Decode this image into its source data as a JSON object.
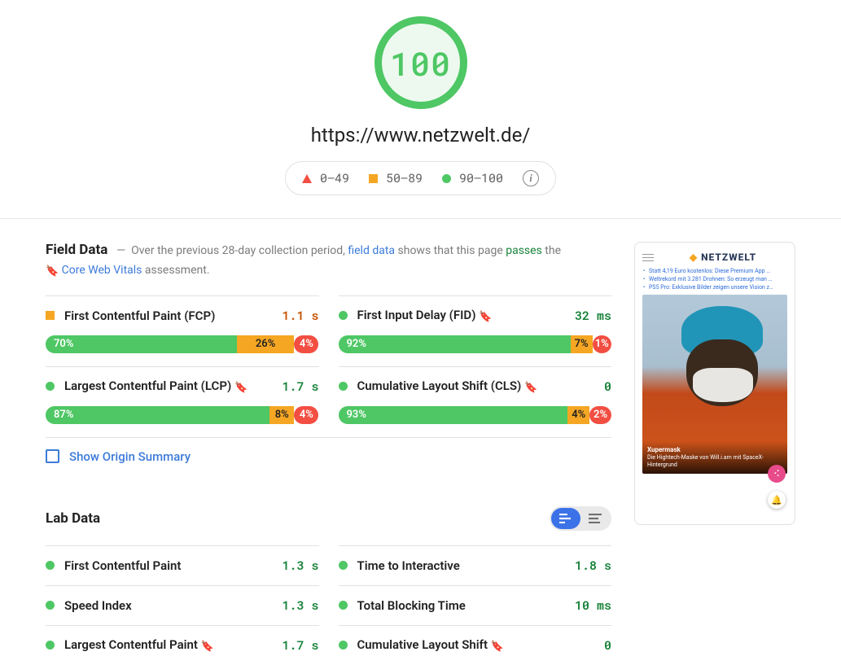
{
  "header": {
    "score": "100",
    "url": "https://www.netzwelt.de/",
    "legend": {
      "poor": "0–49",
      "ni": "50–89",
      "good": "90–100"
    }
  },
  "field": {
    "title": "Field Data",
    "intro_pre": "Over the previous 28-day collection period, ",
    "intro_link1": "field data",
    "intro_mid": " shows that this page ",
    "intro_passes": "passes",
    "intro_post": " the ",
    "intro_cwv": "Core Web Vitals",
    "intro_end": " assessment.",
    "metrics": {
      "fcp": {
        "name": "First Contentful Paint (FCP)",
        "value": "1.1 s",
        "good": "70%",
        "ni": "26%",
        "poor": "4%"
      },
      "fid": {
        "name": "First Input Delay (FID)",
        "value": "32 ms",
        "good": "92%",
        "ni": "7%",
        "poor": "1%"
      },
      "lcp": {
        "name": "Largest Contentful Paint (LCP)",
        "value": "1.7 s",
        "good": "87%",
        "ni": "8%",
        "poor": "4%"
      },
      "cls": {
        "name": "Cumulative Layout Shift (CLS)",
        "value": "0",
        "good": "93%",
        "ni": "4%",
        "poor": "2%"
      }
    },
    "origin_link": "Show Origin Summary"
  },
  "lab": {
    "title": "Lab Data",
    "fcp": {
      "name": "First Contentful Paint",
      "value": "1.3 s"
    },
    "si": {
      "name": "Speed Index",
      "value": "1.3 s"
    },
    "lcp": {
      "name": "Largest Contentful Paint",
      "value": "1.7 s"
    },
    "tti": {
      "name": "Time to Interactive",
      "value": "1.8 s"
    },
    "tbt": {
      "name": "Total Blocking Time",
      "value": "10 ms"
    },
    "cls": {
      "name": "Cumulative Layout Shift",
      "value": "0"
    }
  },
  "preview": {
    "brand": "NETZWELT",
    "li1": "Statt 4,19 Euro kostenlos: Diese Premium App …",
    "li2": "Weltrekord mit 3.281 Drohnen: So erzeugt man …",
    "li3": "PS5 Pro: Exklusive Bilder zeigen unsere Vision z…",
    "cap_title": "Xupermask",
    "cap_text": "Die Hightech-Maske von Will.i.am mit SpaceX-Hintergrund"
  }
}
